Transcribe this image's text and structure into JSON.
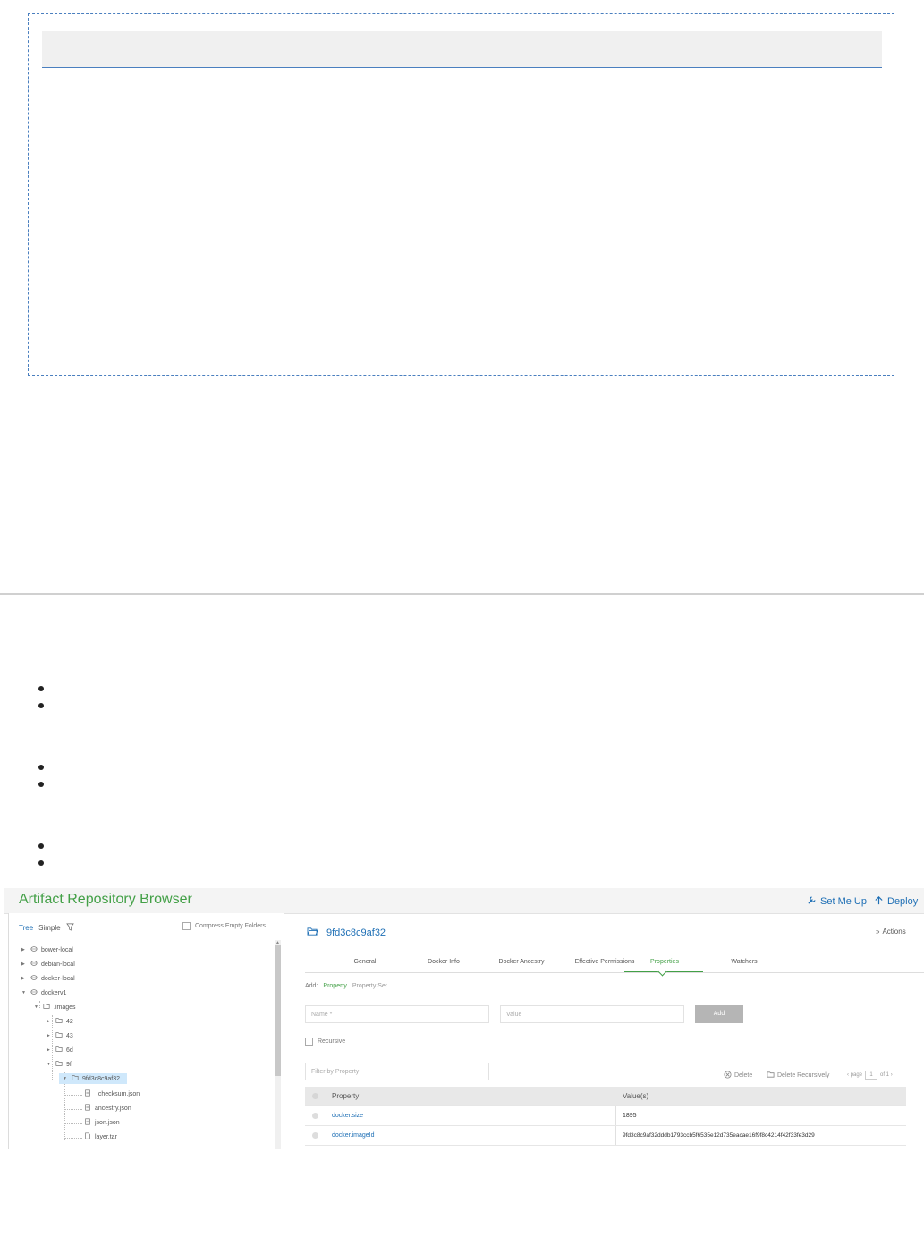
{
  "app": {
    "title": "Artifact Repository Browser",
    "set_me_up": "Set Me Up",
    "deploy": "Deploy"
  },
  "tree_panel": {
    "tab_tree": "Tree",
    "tab_simple": "Simple",
    "compress_label": "Compress Empty Folders",
    "nodes": [
      {
        "label": "bower-local"
      },
      {
        "label": "debian-local"
      },
      {
        "label": "docker-local"
      },
      {
        "label": "dockerv1"
      },
      {
        "label": ".images"
      },
      {
        "label": "42"
      },
      {
        "label": "43"
      },
      {
        "label": "6d"
      },
      {
        "label": "9f"
      },
      {
        "label": "9fd3c8c9af32"
      },
      {
        "label": "_checksum.json"
      },
      {
        "label": "ancestry.json"
      },
      {
        "label": "json.json"
      },
      {
        "label": "layer.tar"
      }
    ]
  },
  "details": {
    "item_name": "9fd3c8c9af32",
    "actions": "Actions",
    "tabs": [
      {
        "label": "General"
      },
      {
        "label": "Docker Info"
      },
      {
        "label": "Docker Ancestry"
      },
      {
        "label": "Effective Permissions"
      },
      {
        "label": "Properties"
      },
      {
        "label": "Watchers"
      }
    ],
    "add_label": "Add:",
    "add_property": "Property",
    "add_property_set": "Property Set",
    "name_placeholder": "Name *",
    "value_placeholder": "Value",
    "add_button": "Add",
    "recursive_label": "Recursive",
    "filter_placeholder": "Filter by Property",
    "delete": "Delete",
    "delete_recursively": "Delete Recursively",
    "pager_prefix": "‹ page",
    "pager_page": "1",
    "pager_suffix": "of 1 ›",
    "table_headers": {
      "property": "Property",
      "values": "Value(s)"
    },
    "rows": [
      {
        "property": "docker.size",
        "value": "1895"
      },
      {
        "property": "docker.imageId",
        "value": "9fd3c8c9af32dddb1793ccb5f6535e12d735eacae16f9f8c4214f42f33fe3d29"
      }
    ]
  }
}
